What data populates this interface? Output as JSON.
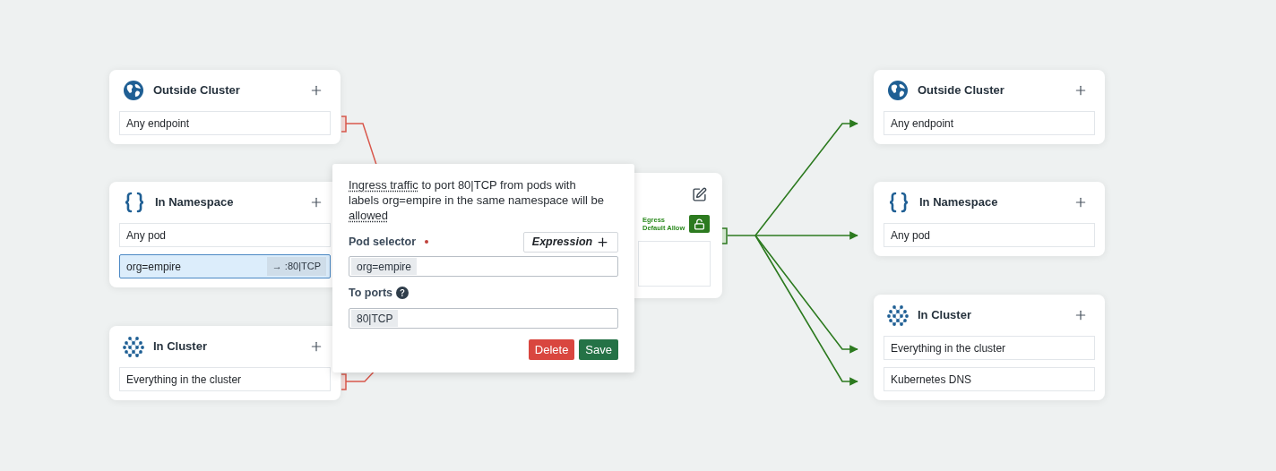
{
  "ingress_sources": [
    {
      "kind": "globe",
      "title": "Outside Cluster",
      "items": [
        {
          "label": "Any endpoint",
          "selected": false
        }
      ]
    },
    {
      "kind": "braces",
      "title": "In Namespace",
      "items": [
        {
          "label": "Any pod",
          "selected": false
        },
        {
          "label": "org=empire",
          "selected": true,
          "port": "→ :80|TCP"
        }
      ]
    },
    {
      "kind": "cluster",
      "title": "In Cluster",
      "items": [
        {
          "label": "Everything in the cluster",
          "selected": false
        }
      ]
    }
  ],
  "policy_node": {
    "egress_label": "Egress Default Allow"
  },
  "rule_popover": {
    "description": [
      {
        "text": "Ingress traffic",
        "underlined": true
      },
      {
        "text": " to port 80|TCP from pods with labels org=empire in the same namespace will be ",
        "underlined": false
      },
      {
        "text": "allowed",
        "underlined": true
      }
    ],
    "pod_selector": {
      "label": "Pod selector",
      "required": true,
      "button": "Expression",
      "tags": [
        "org=empire"
      ]
    },
    "to_ports": {
      "label": "To ports",
      "tags": [
        "80|TCP"
      ]
    },
    "buttons": [
      {
        "kind": "danger",
        "label": "Delete"
      },
      {
        "kind": "primary",
        "label": "Save"
      }
    ]
  },
  "egress_targets": [
    {
      "kind": "globe",
      "title": "Outside Cluster",
      "items": [
        {
          "label": "Any endpoint",
          "selected": false
        }
      ]
    },
    {
      "kind": "braces",
      "title": "In Namespace",
      "items": [
        {
          "label": "Any pod",
          "selected": false
        }
      ]
    },
    {
      "kind": "cluster",
      "title": "In Cluster",
      "items": [
        {
          "label": "Everything in the cluster",
          "selected": false
        },
        {
          "label": "Kubernetes DNS",
          "selected": false
        }
      ]
    }
  ]
}
